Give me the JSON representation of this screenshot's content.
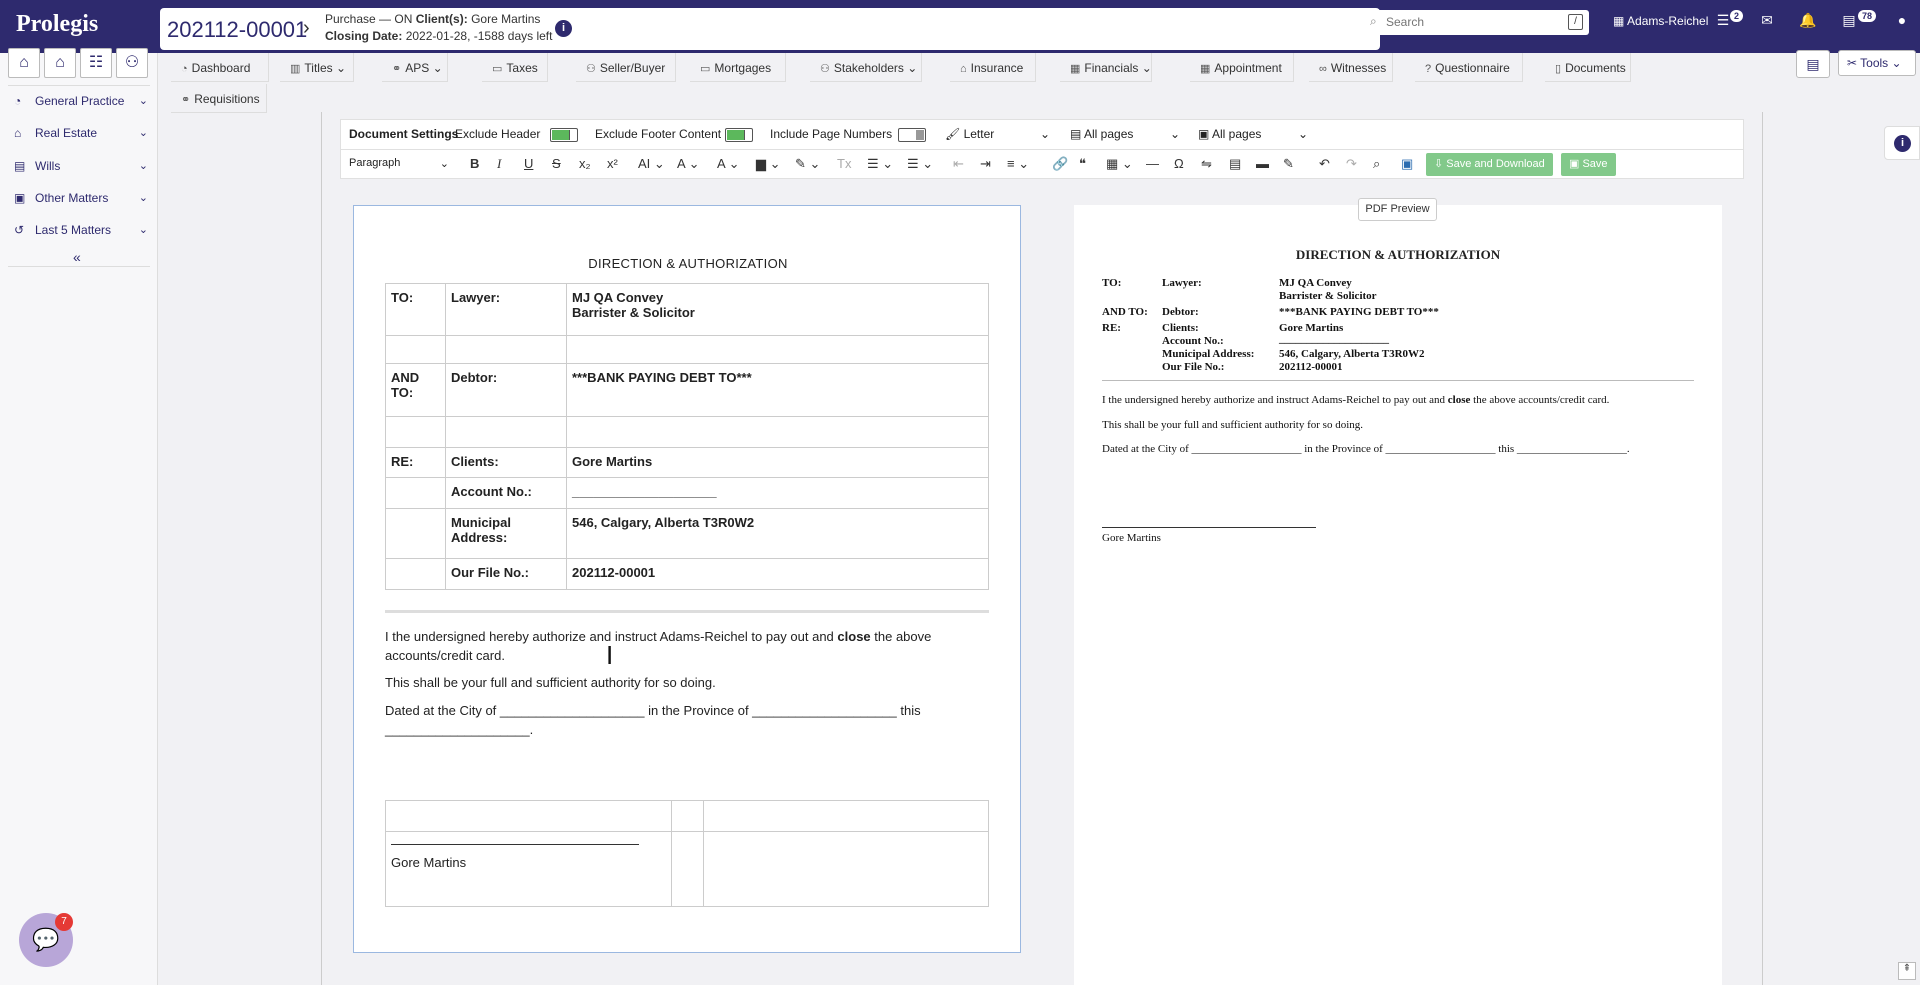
{
  "app": {
    "logo": "Prolegis"
  },
  "matter": {
    "number": "202112-00001",
    "type": "Purchase — ON",
    "clients_label": "Client(s):",
    "clients": "Gore Martins",
    "closing_label": "Closing Date:",
    "closing": "2022-01-28, -1588 days left"
  },
  "topbar": {
    "search_placeholder": "Search",
    "search_shortcut": "/",
    "firm": "Adams-Reichel",
    "tasks_badge": "2",
    "docs_badge": "78"
  },
  "sidebar": {
    "items": [
      {
        "label": "General Practice",
        "icon": "gauge-icon"
      },
      {
        "label": "Real Estate",
        "icon": "home-icon"
      },
      {
        "label": "Wills",
        "icon": "document-icon"
      },
      {
        "label": "Other Matters",
        "icon": "briefcase-icon"
      },
      {
        "label": "Last 5 Matters",
        "icon": "history-icon"
      }
    ],
    "collapse": "«",
    "chat_badge": "7"
  },
  "tabs": [
    {
      "label": "Dashboard"
    },
    {
      "label": "Titles"
    },
    {
      "label": "APS"
    },
    {
      "label": "Taxes"
    },
    {
      "label": "Seller/Buyer"
    },
    {
      "label": "Mortgages"
    },
    {
      "label": "Stakeholders"
    },
    {
      "label": "Insurance"
    },
    {
      "label": "Financials"
    },
    {
      "label": "Appointment"
    },
    {
      "label": "Witnesses"
    },
    {
      "label": "Questionnaire"
    },
    {
      "label": "Documents"
    },
    {
      "label": "Requisitions"
    }
  ],
  "tools": "Tools",
  "settings": {
    "title": "Document Settings",
    "exclude_header": "Exclude Header",
    "exclude_footer": "Exclude Footer Content",
    "include_page_numbers": "Include Page Numbers",
    "paper": "Letter",
    "header_pages": "All pages",
    "footer_pages": "All pages",
    "exclude_header_on": true,
    "exclude_footer_on": true,
    "page_numbers_on": false
  },
  "editor_toolbar": {
    "block_style": "Paragraph",
    "save_download": "Save and Download",
    "save": "Save"
  },
  "pdf_preview_label": "PDF Preview",
  "document": {
    "title": "DIRECTION & AUTHORIZATION",
    "to_label": "TO:",
    "lawyer_label": "Lawyer:",
    "lawyer_name": "MJ QA Convey",
    "lawyer_title": "Barrister & Solicitor",
    "and_to_label": "AND TO:",
    "debtor_label": "Debtor:",
    "debtor": "***BANK PAYING DEBT TO***",
    "re_label": "RE:",
    "clients_label": "Clients:",
    "clients": "Gore Martins",
    "account_label": "Account No.:",
    "account": "____________________",
    "municipal_label": "Municipal Address:",
    "municipal": "546, Calgary, Alberta T3R0W2",
    "file_label": "Our File No.:",
    "file": "202112-00001",
    "para1_a": "I the undersigned hereby authorize and instruct Adams-Reichel to pay out and ",
    "para1_b": "close",
    "para1_c": " the above accounts/credit card.",
    "para2": "This shall be your full and sufficient authority for so doing.",
    "para3": "Dated at the City of ____________________ in the Province of ____________________ this ____________________.",
    "signer": "Gore Martins"
  },
  "preview": {
    "title": "DIRECTION & AUTHORIZATION",
    "to_label": "TO:",
    "lawyer_label": "Lawyer:",
    "lawyer_name": "MJ QA Convey",
    "lawyer_title": "Barrister & Solicitor",
    "and_to_label": "AND TO:",
    "debtor_label": "Debtor:",
    "debtor": "***BANK PAYING DEBT TO***",
    "re_label": "RE:",
    "clients_label": "Clients:",
    "clients": "Gore Martins",
    "account_label": "Account No.:",
    "account": "____________________",
    "municipal_label": "Municipal Address:",
    "municipal": "546, Calgary, Alberta T3R0W2",
    "file_label": "Our File No.:",
    "file": "202112-00001",
    "para1_a": "I the undersigned hereby authorize and instruct Adams-Reichel to pay out and ",
    "para1_b": "close",
    "para1_c": " the above accounts/credit card.",
    "para2": "This shall be your full and sufficient authority for so doing.",
    "para3": "Dated at the City of ____________________ in the Province of ____________________ this ____________________.",
    "signer": "Gore Martins"
  },
  "colors": {
    "brand": "#2e2a6e",
    "accent_green": "#5cb85c"
  }
}
